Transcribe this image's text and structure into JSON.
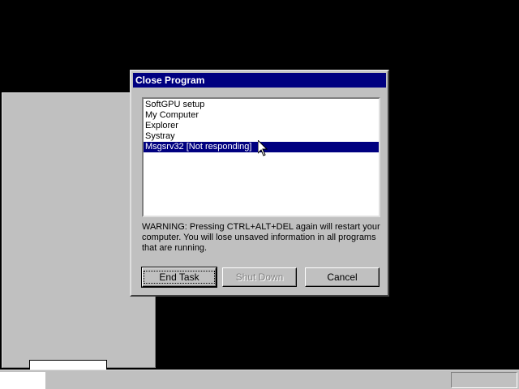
{
  "dialog": {
    "title": "Close Program",
    "programs": [
      {
        "label": "SoftGPU setup",
        "selected": false
      },
      {
        "label": "My Computer",
        "selected": false
      },
      {
        "label": "Explorer",
        "selected": false
      },
      {
        "label": "Systray",
        "selected": false
      },
      {
        "label": "Msgsrv32 [Not responding]",
        "selected": true
      }
    ],
    "warning": "WARNING: Pressing CTRL+ALT+DEL again will restart your computer. You will lose unsaved information in all programs that are running.",
    "buttons": {
      "end_task": "End Task",
      "shut_down": "Shut Down",
      "cancel": "Cancel"
    }
  },
  "colors": {
    "title_bar": "#000080",
    "selection": "#000080",
    "face": "#c0c0c0",
    "desktop": "#000000"
  },
  "icons": {
    "cursor": "arrow-pointer-icon"
  }
}
